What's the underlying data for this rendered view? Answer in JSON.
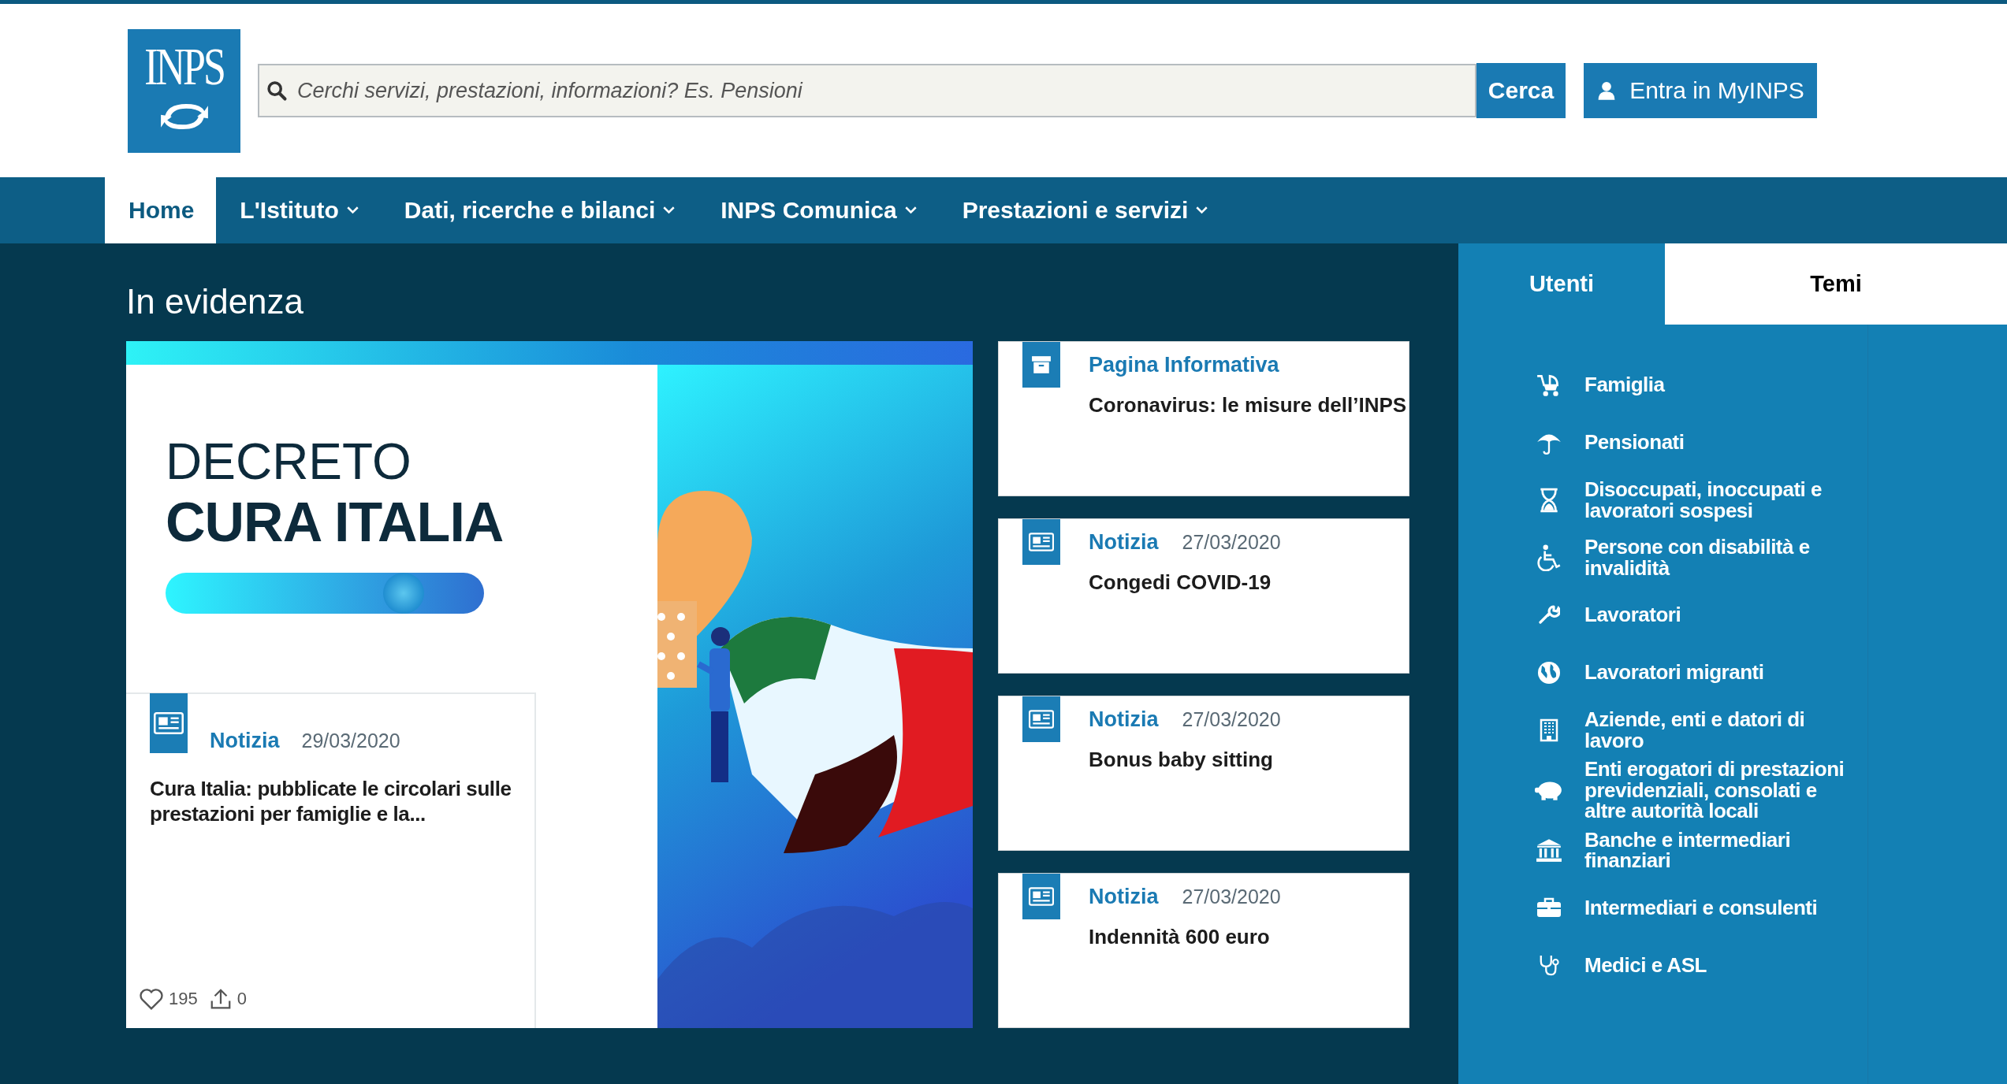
{
  "header": {
    "logo": "INPS",
    "search": {
      "placeholder": "Cerchi servizi, prestazioni, informazioni? Es. Pensioni"
    },
    "search_button": "Cerca",
    "login_button": "Entra in MyINPS"
  },
  "nav": [
    {
      "label": "Home",
      "selected": true,
      "dropdown": false
    },
    {
      "label": "L'Istituto",
      "selected": false,
      "dropdown": true
    },
    {
      "label": "Dati, ricerche e bilanci",
      "selected": false,
      "dropdown": true
    },
    {
      "label": "INPS Comunica",
      "selected": false,
      "dropdown": true
    },
    {
      "label": "Prestazioni e servizi",
      "selected": false,
      "dropdown": true
    }
  ],
  "section_title": "In evidenza",
  "featured": {
    "banner": {
      "line_1": "DECRETO",
      "line_2": "CURA ITALIA"
    },
    "type": "Notizia",
    "date": "29/03/2020",
    "title": "Cura Italia: pubblicate le circolari sulle prestazioni per famiglie e la...",
    "likes": "195",
    "shares": "0"
  },
  "news": [
    {
      "kind": "page",
      "type": "Pagina Informativa",
      "title": "Coronavirus: le misure dell’INPS"
    },
    {
      "kind": "news",
      "type": "Notizia",
      "date": "27/03/2020",
      "title": "Congedi COVID-19"
    },
    {
      "kind": "news",
      "type": "Notizia",
      "date": "27/03/2020",
      "title": "Bonus baby sitting"
    },
    {
      "kind": "news",
      "type": "Notizia",
      "date": "27/03/2020",
      "title": "Indennità 600 euro"
    }
  ],
  "sidebar": {
    "tabs": [
      {
        "label": "Utenti",
        "selected": true
      },
      {
        "label": "Temi",
        "selected": false
      }
    ],
    "items": [
      {
        "kind": "stroller",
        "label": "Famiglia"
      },
      {
        "kind": "umbrella",
        "label": "Pensionati"
      },
      {
        "kind": "hourglass",
        "label": "Disoccupati, inoccupati e lavoratori sospesi"
      },
      {
        "kind": "wheelchair",
        "label": "Persone con disabilità e invalidità"
      },
      {
        "kind": "wrench",
        "label": "Lavoratori"
      },
      {
        "kind": "globe",
        "label": "Lavoratori migranti"
      },
      {
        "kind": "building",
        "label": "Aziende, enti e datori di lavoro"
      },
      {
        "kind": "piggy",
        "label": "Enti erogatori di prestazioni previdenziali, consolati e altre autorità locali"
      },
      {
        "kind": "bank",
        "label": "Banche e intermediari finanziari"
      },
      {
        "kind": "briefcase",
        "label": "Intermediari e consulenti"
      },
      {
        "kind": "stethoscope",
        "label": "Medici e ASL"
      }
    ]
  }
}
